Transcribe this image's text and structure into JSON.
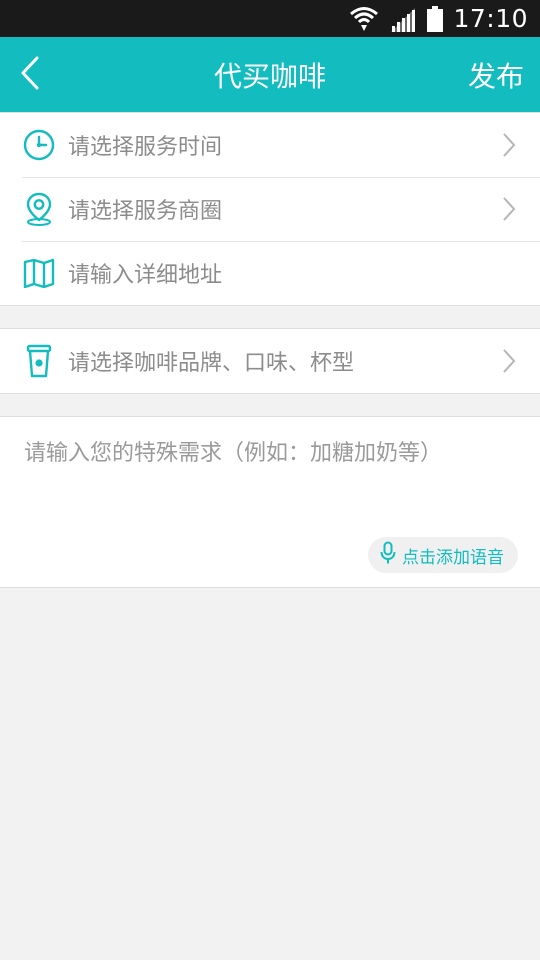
{
  "status": {
    "time": "17:10"
  },
  "header": {
    "title": "代买咖啡",
    "action": "发布"
  },
  "form": {
    "time_label": "请选择服务时间",
    "area_label": "请选择服务商圈",
    "address_placeholder": "请输入详细地址",
    "coffee_label": "请选择咖啡品牌、口味、杯型",
    "request_placeholder": "请输入您的特殊需求（例如：加糖加奶等）",
    "voice_label": "点击添加语音"
  },
  "colors": {
    "accent": "#12bcbf",
    "statusbar": "#1a1a1a",
    "background": "#f2f2f2",
    "text_hint": "#8c8c8c"
  },
  "icons": [
    "wifi-icon",
    "signal-icon",
    "battery-icon",
    "back-arrow-icon",
    "clock-icon",
    "location-pin-icon",
    "map-icon",
    "coffee-cup-icon",
    "chevron-right-icon",
    "microphone-icon"
  ]
}
